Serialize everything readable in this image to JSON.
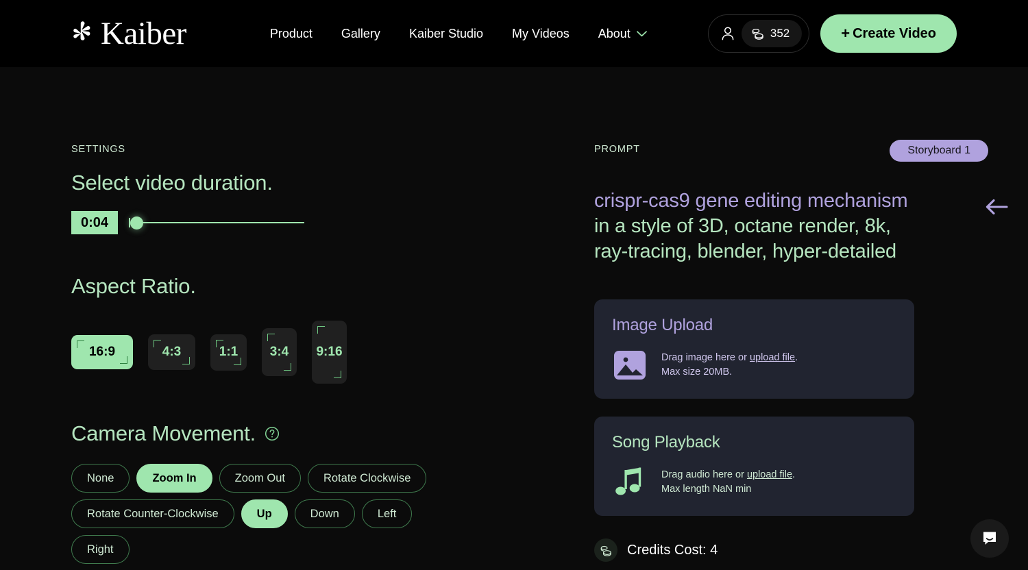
{
  "header": {
    "brand_name": "Kaiber",
    "nav": [
      {
        "label": "Product",
        "has_chevron": false
      },
      {
        "label": "Gallery",
        "has_chevron": false
      },
      {
        "label": "Kaiber Studio",
        "has_chevron": false
      },
      {
        "label": "My Videos",
        "has_chevron": false
      },
      {
        "label": "About",
        "has_chevron": true
      }
    ],
    "credits": "352",
    "create_button": "Create Video",
    "create_plus": "+"
  },
  "settings": {
    "eyebrow": "SETTINGS",
    "duration": {
      "title": "Select video duration.",
      "value": "0:04",
      "slider_position_pct": 2
    },
    "aspect": {
      "title": "Aspect Ratio.",
      "options": [
        {
          "label": "16:9",
          "selected": true
        },
        {
          "label": "4:3",
          "selected": false
        },
        {
          "label": "1:1",
          "selected": false
        },
        {
          "label": "3:4",
          "selected": false
        },
        {
          "label": "9:16",
          "selected": false
        }
      ]
    },
    "camera": {
      "title": "Camera Movement.",
      "help_icon": "question-circle-icon",
      "rows": [
        [
          {
            "label": "None",
            "selected": false
          },
          {
            "label": "Zoom In",
            "selected": true
          },
          {
            "label": "Zoom Out",
            "selected": false
          },
          {
            "label": "Rotate Clockwise",
            "selected": false
          }
        ],
        [
          {
            "label": "Rotate Counter-Clockwise",
            "selected": false
          },
          {
            "label": "Up",
            "selected": true
          },
          {
            "label": "Down",
            "selected": false
          },
          {
            "label": "Left",
            "selected": false
          }
        ],
        [
          {
            "label": "Right",
            "selected": false
          }
        ]
      ]
    }
  },
  "prompt": {
    "eyebrow": "PROMPT",
    "storyboard_badge": "Storyboard 1",
    "subject_text": "crispr-cas9 gene editing mechanism",
    "style_text": "in a style of 3D, octane render, 8k, ray-tracing, blender, hyper-detailed",
    "back_arrow": "arrow-left-icon"
  },
  "image_upload": {
    "title": "Image Upload",
    "drag_prefix": "Drag image here or ",
    "link": "upload file",
    "drag_suffix": ".",
    "limit": "Max size 20MB."
  },
  "song_playback": {
    "title": "Song Playback",
    "drag_prefix": "Drag audio here or ",
    "link": "upload file",
    "drag_suffix": ".",
    "limit": "Max length NaN min"
  },
  "credits_cost": {
    "text": "Credits Cost: 4"
  },
  "chat_widget": {
    "icon": "chat-bubble-icon"
  },
  "colors": {
    "accent_green": "#9fe6ae",
    "text_green": "#b5e5bf",
    "accent_purple": "#b0a2de",
    "page_bg": "#0b0b0b",
    "header_bg": "#000000",
    "card_bg": "#212430"
  }
}
